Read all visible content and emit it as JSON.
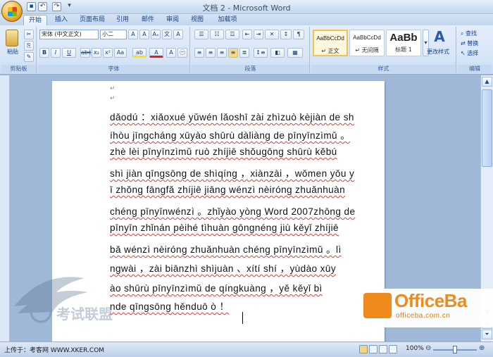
{
  "window": {
    "title": "文档 2 - Microsoft Word"
  },
  "qat": {
    "icons": [
      "save-icon",
      "undo-icon",
      "redo-icon",
      "customize-icon"
    ]
  },
  "tabs": [
    {
      "label": "开始",
      "active": true
    },
    {
      "label": "插入",
      "active": false
    },
    {
      "label": "页面布局",
      "active": false
    },
    {
      "label": "引用",
      "active": false
    },
    {
      "label": "邮件",
      "active": false
    },
    {
      "label": "审阅",
      "active": false
    },
    {
      "label": "视图",
      "active": false
    },
    {
      "label": "加载项",
      "active": false
    }
  ],
  "ribbon": {
    "clipboard": {
      "paste_label": "粘贴",
      "group_label": "剪贴板"
    },
    "font": {
      "font_name": "宋体 (中文正文)",
      "font_size": "小二",
      "group_label": "字体"
    },
    "paragraph": {
      "group_label": "段落"
    },
    "styles": {
      "items": [
        {
          "sample": "AaBbCcDd",
          "name": "↵ 正文",
          "selected": true
        },
        {
          "sample": "AaBbCcDd",
          "name": "↵ 无间隔",
          "selected": false
        },
        {
          "sample": "AaBb",
          "name": "标题 1",
          "selected": false
        }
      ],
      "change_styles_label": "更改样式",
      "group_label": "样式"
    },
    "editing": {
      "find": "查找",
      "replace": "替换",
      "select": "选择",
      "group_label": "编辑"
    }
  },
  "document": {
    "lines": [
      "dǎodú  ：xiǎoxué  yǔwén lǎoshī  zài zhìzuò  kèjiàn de sh",
      "íhòu jīngcháng xūyào shūrù  dàliàng de pīnyīnzìmǔ  。",
      "zhè lèi  pīnyīnzìmǔ ruò  zhíjiē  shǒugōng  shūrù kěbú",
      "shì  jiàn qīngsōng de shìqíng  ，xiànzài ，wǒmen yǒu y",
      "ī  zhǒng fāngfǎ  zhíjiē  jiāng wénzì  nèiróng zhuǎnhuàn",
      "chéng pīnyīnwénzì  。zhǐyào yòng Word 2007zhōng de",
      "pīnyīn zhǐnán pèihé  tìhuàn gōngnéng jiù  kěyǐ  zhíjiē",
      "bǎ  wénzì  nèiróng zhuǎnhuàn chéng pīnyīnzìmǔ  。lì",
      "ngwài  ，zài biānzhì  shìjuàn  、xítí  shí  ，yùdào xūy",
      "ào shūrù  pīnyīnzìmǔ de  qíngkuàng  ，yě kěyǐ  bì",
      "nde qīngsōng hěnduō  ò  ！"
    ]
  },
  "statusbar": {
    "text": "上传于：考客网  WWW.XKER.COM",
    "zoom": "100%",
    "zoom_percent": 100
  },
  "watermark": {
    "brand": "OfficeBa",
    "url": "officeba.com.cn",
    "left_text": "考试联盟"
  }
}
